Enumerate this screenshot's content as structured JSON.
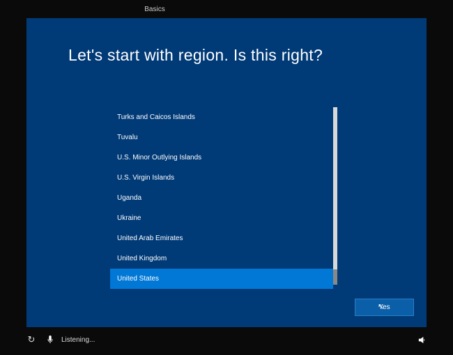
{
  "tabs": {
    "active": "Basics"
  },
  "heading": "Let's start with region. Is this right?",
  "regions": [
    "Turks and Caicos Islands",
    "Tuvalu",
    "U.S. Minor Outlying Islands",
    "U.S. Virgin Islands",
    "Uganda",
    "Ukraine",
    "United Arab Emirates",
    "United Kingdom",
    "United States"
  ],
  "selected_region": "United States",
  "buttons": {
    "yes": "Yes"
  },
  "status": {
    "cortana": "Listening..."
  }
}
